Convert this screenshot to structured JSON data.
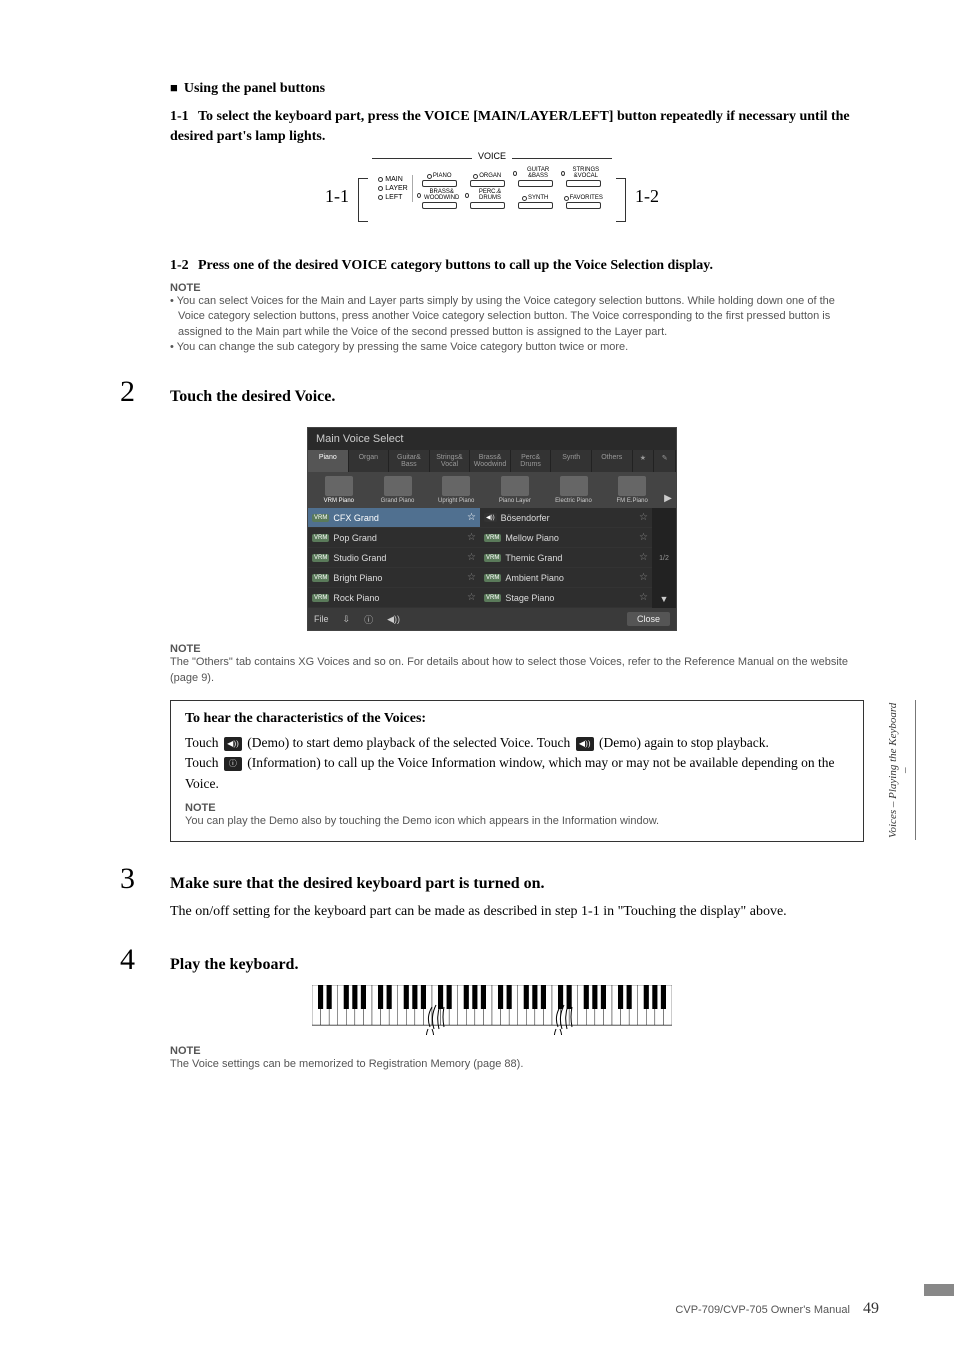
{
  "heading_panel": "Using the panel buttons",
  "step_1_1": "To select the keyboard part, press the VOICE [MAIN/LAYER/LEFT] button repeatedly if necessary until the desired part's lamp lights.",
  "voice_label": "VOICE",
  "ml": {
    "main": "MAIN",
    "layer": "LAYER",
    "left": "LEFT"
  },
  "cats": {
    "r1": [
      "PIANO",
      "ORGAN",
      "GUITAR &BASS",
      "STRINGS &VOCAL"
    ],
    "r2": [
      "BRASS& WOODWIND",
      "PERC.& DRUMS",
      "SYNTH",
      "FAVORITES"
    ]
  },
  "label_1_1": "1-1",
  "label_1_2": "1-2",
  "step_1_2": "Press one of the desired VOICE category buttons to call up the Voice Selection display.",
  "note_label": "NOTE",
  "note1_b1": "You can select Voices for the Main and Layer parts simply by using the Voice category selection buttons. While holding down one of the Voice category selection buttons, press another Voice category selection button. The Voice corresponding to the first pressed button is assigned to the Main part while the Voice of the second pressed button is assigned to the Layer part.",
  "note1_b2": "You can change the sub category by pressing the same Voice category button twice or more.",
  "step2": "Touch the desired Voice.",
  "ss": {
    "title": "Main Voice Select",
    "tabs": [
      "Piano",
      "Organ",
      "Guitar& Bass",
      "Strings& Vocal",
      "Brass& Woodwind",
      "Perc& Drums",
      "Synth",
      "Others"
    ],
    "subcats": [
      "VRM Piano",
      "Grand Piano",
      "Upright Piano",
      "Piano Layer",
      "Electric Piano",
      "FM E.Piano"
    ],
    "left": [
      "CFX Grand",
      "Pop Grand",
      "Studio Grand",
      "Bright Piano",
      "Rock Piano"
    ],
    "right": [
      "Bösendorfer",
      "Mellow Piano",
      "Themic Grand",
      "Ambient Piano",
      "Stage Piano"
    ],
    "page": "1/2",
    "file": "File",
    "close": "Close"
  },
  "note2": "The \"Others\" tab contains XG Voices and so on. For details about how to select those Voices, refer to the Reference Manual on the website (page 9).",
  "box": {
    "title": "To hear the characteristics of the Voices:",
    "l1a": "Touch ",
    "l1b": " (Demo) to start demo playback of the selected Voice. Touch ",
    "l1c": " (Demo) again to stop playback.",
    "l2a": "Touch ",
    "l2b": " (Information) to call up the Voice Information window, which may or may not be available depending on the Voice.",
    "note": "You can play the Demo also by touching the Demo icon which appears in the Information window."
  },
  "step3_title": "Make sure that the desired keyboard part is turned on.",
  "step3_body": "The on/off setting for the keyboard part can be made as described in step 1-1 in \"Touching the display\" above.",
  "step4_title": "Play the keyboard.",
  "note4": "The Voice settings can be memorized to Registration Memory (page 88).",
  "side": "Voices – Playing the Keyboard –",
  "footer_text": "CVP-709/CVP-705 Owner's Manual",
  "page": "49"
}
